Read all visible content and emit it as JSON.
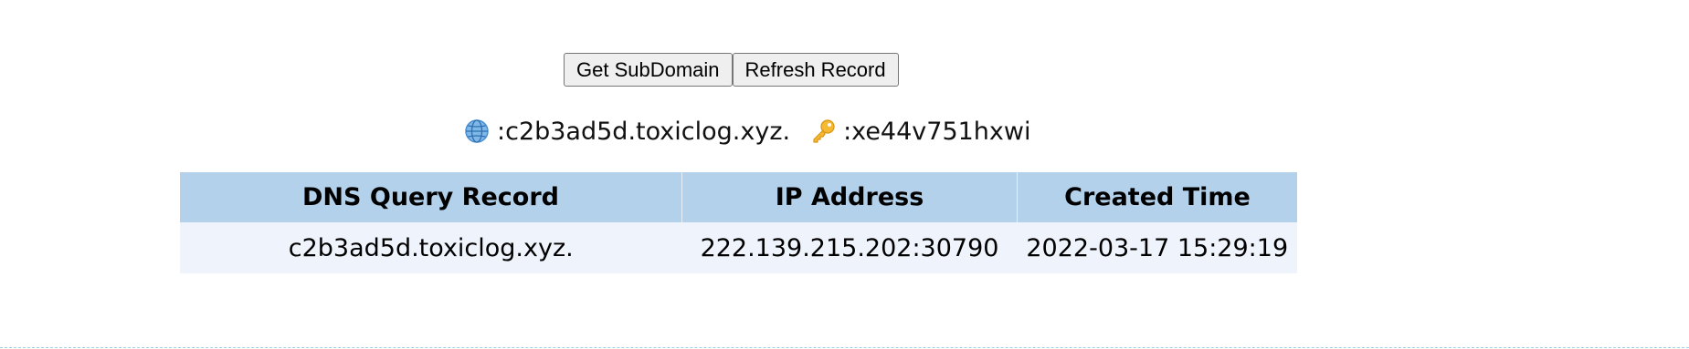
{
  "toolbar": {
    "get_subdomain_label": "Get SubDomain",
    "refresh_record_label": "Refresh Record"
  },
  "info": {
    "domain_icon": "globe-icon",
    "domain_text": ":c2b3ad5d.toxiclog.xyz.",
    "token_icon": "key-icon",
    "token_text": ":xe44v751hxwi"
  },
  "table": {
    "columns": [
      "DNS Query Record",
      "IP Address",
      "Created Time"
    ],
    "rows": [
      [
        "c2b3ad5d.toxiclog.xyz.",
        "222.139.215.202:30790",
        "2022-03-17 15:29:19"
      ]
    ]
  },
  "colors": {
    "header_bg": "#b3d1ea",
    "row_bg": "#eff3fc",
    "divider": "#9fd0e6"
  }
}
